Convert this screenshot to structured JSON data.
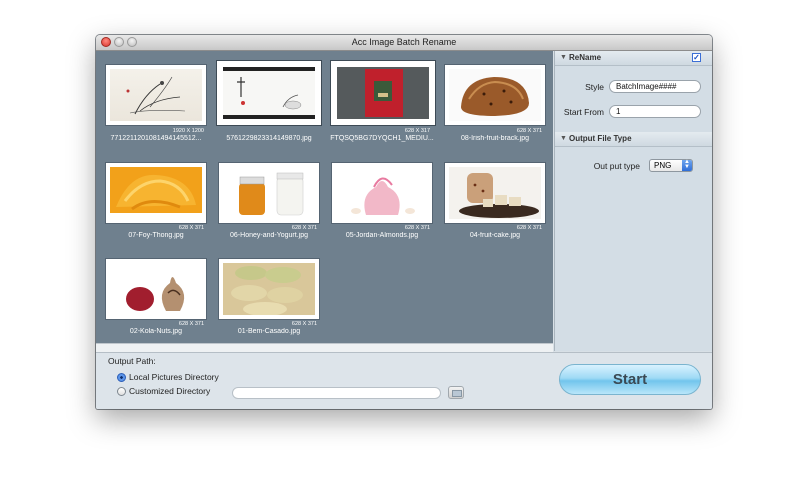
{
  "window": {
    "title": "Acc Image Batch Rename"
  },
  "thumbnails": [
    {
      "dims": "1920 X 1200",
      "name": "771221120108149414551​2..."
    },
    {
      "dims": "",
      "name": "5761229823314149870.jpg"
    },
    {
      "dims": "628 X 317",
      "name": "FTQSQ5BG7DYQCH1_MEDIU..."
    },
    {
      "dims": "628 X 371",
      "name": "08-Irish-fruit-brack.jpg"
    },
    {
      "dims": "628 X 371",
      "name": "07-Foy-Thong.jpg"
    },
    {
      "dims": "628 X 371",
      "name": "06-Honey-and-Yogurt.jpg"
    },
    {
      "dims": "628 X 371",
      "name": "05-Jordan-Almonds.jpg"
    },
    {
      "dims": "628 X 371",
      "name": "04-fruit-cake.jpg"
    },
    {
      "dims": "628 X 371",
      "name": "02-Kola-Nuts.jpg"
    },
    {
      "dims": "628 X 371",
      "name": "01-Bem-Casado.jpg"
    }
  ],
  "rename": {
    "header": "ReName",
    "enabled": true,
    "style_label": "Style",
    "style_value": "BatchImage####",
    "start_label": "Start From",
    "start_value": "1"
  },
  "output_type": {
    "header": "Output File Type",
    "label": "Out put type",
    "value": "PNG"
  },
  "output_path": {
    "label": "Output Path:",
    "option_local": "Local Pictures Directory",
    "option_custom": "Customized Directory",
    "selected": "local",
    "custom_path": ""
  },
  "start_label": "Start",
  "icons": [
    "close-icon",
    "minimize-icon",
    "zoom-icon",
    "checkbox-icon",
    "folder-icon",
    "select-arrows-icon"
  ]
}
